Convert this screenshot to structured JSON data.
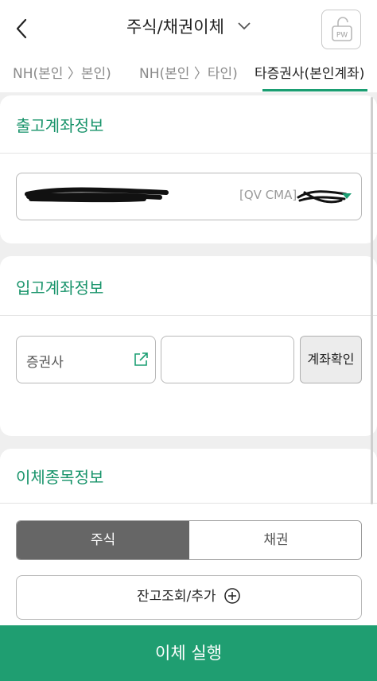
{
  "header": {
    "title": "주식/채권이체",
    "pw_label": "PW"
  },
  "tabs": [
    {
      "label": "NH(본인 〉본인)"
    },
    {
      "label": "NH(본인 〉타인)"
    },
    {
      "label": "타증권사(본인계좌)"
    }
  ],
  "withdraw": {
    "title": "출고계좌정보",
    "account_type": "[QV CMA]"
  },
  "deposit": {
    "title": "입고계좌정보",
    "broker_label": "증권사",
    "confirm_label": "계좌확인"
  },
  "transfer_items": {
    "title": "이체종목정보",
    "segments": [
      "주식",
      "채권"
    ],
    "add_label": "잔고조회/추가"
  },
  "execute_label": "이체 실행",
  "colors": {
    "accent": "#1a9e72",
    "button": "#1f9e71",
    "segment_active": "#666666"
  }
}
